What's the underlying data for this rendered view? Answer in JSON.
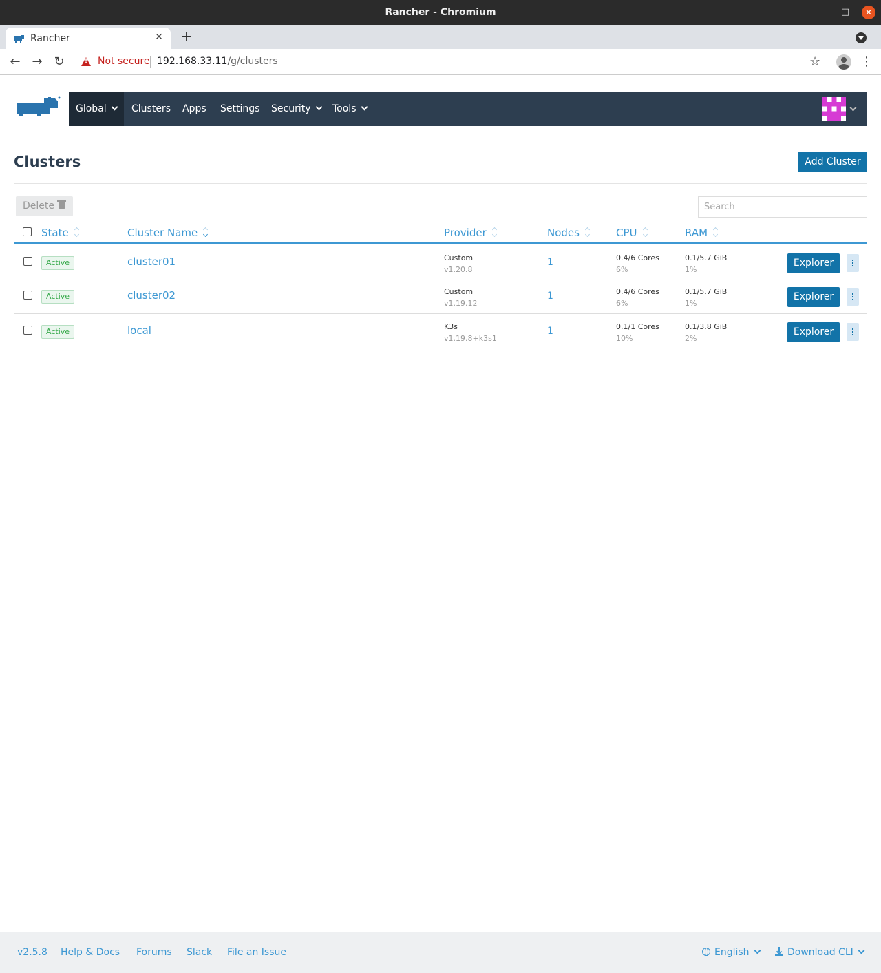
{
  "window": {
    "title": "Rancher - Chromium"
  },
  "browser": {
    "tab_title": "Rancher",
    "security_text": "Not secure",
    "url_host": "192.168.33.11",
    "url_path": "/g/clusters"
  },
  "nav": {
    "items": [
      {
        "label": "Global",
        "dropdown": true,
        "active": true
      },
      {
        "label": "Clusters"
      },
      {
        "label": "Apps"
      },
      {
        "label": "Settings"
      },
      {
        "label": "Security",
        "dropdown": true
      },
      {
        "label": "Tools",
        "dropdown": true
      }
    ]
  },
  "page": {
    "title": "Clusters",
    "add_label": "Add Cluster",
    "delete_label": "Delete",
    "search_placeholder": "Search"
  },
  "table": {
    "headers": {
      "state": "State",
      "name": "Cluster Name",
      "provider": "Provider",
      "nodes": "Nodes",
      "cpu": "CPU",
      "ram": "RAM"
    },
    "rows": [
      {
        "state": "Active",
        "name": "cluster01",
        "provider": "Custom",
        "version": "v1.20.8",
        "nodes": "1",
        "cpu": "0.4/6 Cores",
        "cpu_pct": "6%",
        "ram": "0.1/5.7 GiB",
        "ram_pct": "1%",
        "action": "Explorer"
      },
      {
        "state": "Active",
        "name": "cluster02",
        "provider": "Custom",
        "version": "v1.19.12",
        "nodes": "1",
        "cpu": "0.4/6 Cores",
        "cpu_pct": "6%",
        "ram": "0.1/5.7 GiB",
        "ram_pct": "1%",
        "action": "Explorer"
      },
      {
        "state": "Active",
        "name": "local",
        "provider": "K3s",
        "version": "v1.19.8+k3s1",
        "nodes": "1",
        "cpu": "0.1/1 Cores",
        "cpu_pct": "10%",
        "ram": "0.1/3.8 GiB",
        "ram_pct": "2%",
        "action": "Explorer"
      }
    ]
  },
  "footer": {
    "version": "v2.5.8",
    "help": "Help & Docs",
    "forums": "Forums",
    "slack": "Slack",
    "issue": "File an Issue",
    "language": "English",
    "download": "Download CLI"
  },
  "colors": {
    "nav_bg": "#2d3e50",
    "primary": "#1273a8",
    "link": "#3d98d3",
    "active_badge": "#36a94a",
    "avatar": "#d63bd4"
  }
}
